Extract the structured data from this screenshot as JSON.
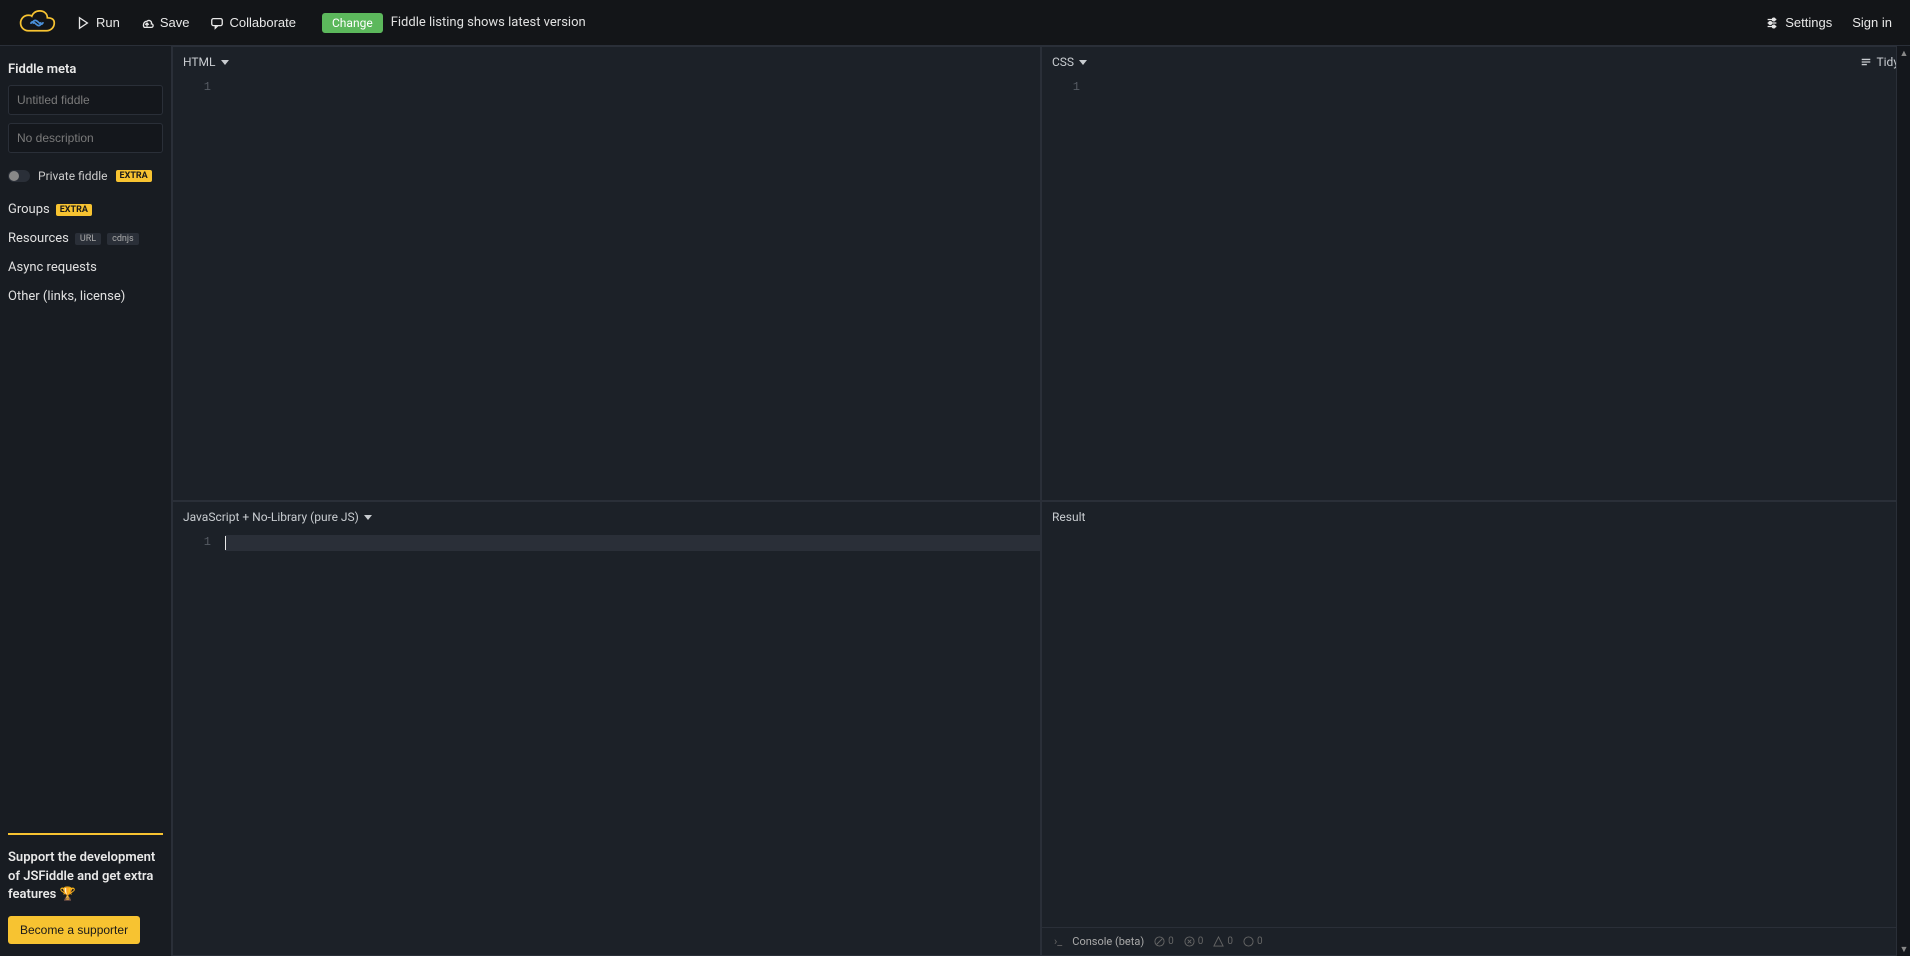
{
  "header": {
    "run_label": "Run",
    "save_label": "Save",
    "collaborate_label": "Collaborate",
    "change_label": "Change",
    "status_text": "Fiddle listing shows latest version",
    "settings_label": "Settings",
    "signin_label": "Sign in"
  },
  "sidebar": {
    "meta_title": "Fiddle meta",
    "title_placeholder": "Untitled fiddle",
    "desc_placeholder": "No description",
    "private_label": "Private fiddle",
    "extra_badge": "EXTRA",
    "groups_label": "Groups",
    "resources_label": "Resources",
    "url_badge": "URL",
    "cdnjs_badge": "cdnjs",
    "async_label": "Async requests",
    "other_label": "Other (links, license)",
    "support_text": "Support the development of JSFiddle and get extra features 🏆",
    "supporter_btn": "Become a supporter"
  },
  "panes": {
    "html_label": "HTML",
    "css_label": "CSS",
    "js_label": "JavaScript + No-Library (pure JS)",
    "result_label": "Result",
    "tidy_label": "Tidy",
    "line_1": "1"
  },
  "console": {
    "label": "Console (beta)",
    "count_0": "0",
    "count_1": "0",
    "count_2": "0",
    "count_3": "0"
  }
}
